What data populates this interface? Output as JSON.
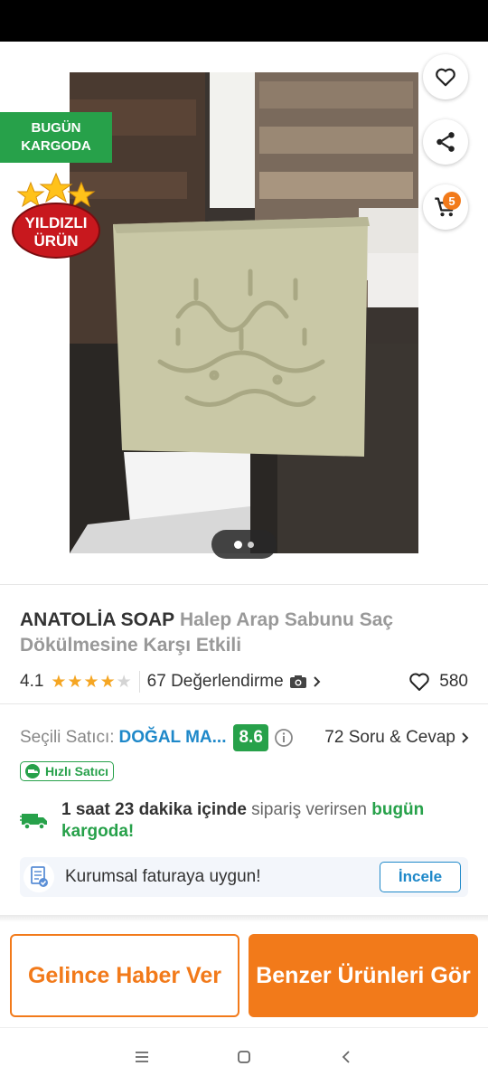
{
  "badges": {
    "cargo_line1": "BUGÜN",
    "cargo_line2": "KARGODA",
    "star_line1": "YILDIZLI",
    "star_line2": "ÜRÜN"
  },
  "cart": {
    "count": "5"
  },
  "gallery": {
    "pages": 2,
    "current": 1
  },
  "product": {
    "brand": "ANATOLİA SOAP",
    "name": "Halep Arap Sabunu Saç Dökülmesine Karşı Etkili",
    "rating": "4.1",
    "rating_value": 4.1,
    "reviews_label": "67 Değerlendirme",
    "favorites": "580"
  },
  "seller": {
    "prefix": "Seçili Satıcı:",
    "name": "DOĞAL MA...",
    "score": "8.6",
    "qa_label": "72 Soru & Cevap",
    "fast_badge": "Hızlı Satıcı"
  },
  "delivery": {
    "time": "1 saat 23 dakika içinde",
    "middle": " sipariş verirsen ",
    "highlight": "bugün kargoda!"
  },
  "invoice": {
    "text": "Kurumsal faturaya uygun!",
    "button": "İncele"
  },
  "actions": {
    "notify": "Gelince Haber Ver",
    "similar": "Benzer Ürünleri Gör"
  },
  "colors": {
    "accent": "#f27a1a",
    "green": "#27a14a",
    "link": "#1e88c9"
  },
  "icons": {
    "back": "arrow-left-icon",
    "favorite": "heart-icon",
    "share": "share-icon",
    "cart": "cart-icon",
    "camera": "camera-icon",
    "info": "info-icon",
    "truck": "truck-icon",
    "invoice": "invoice-icon"
  }
}
